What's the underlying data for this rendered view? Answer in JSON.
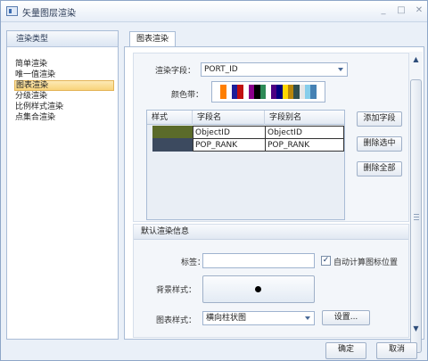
{
  "window": {
    "title": "矢量图层渲染",
    "controls": [
      "_",
      "□",
      "✕"
    ]
  },
  "left_panel": {
    "header": "渲染类型",
    "items": [
      {
        "label": "简单渲染",
        "selected": false
      },
      {
        "label": "唯一值渲染",
        "selected": false
      },
      {
        "label": "图表渲染",
        "selected": true
      },
      {
        "label": "分级渲染",
        "selected": false
      },
      {
        "label": "比例样式渲染",
        "selected": false
      },
      {
        "label": "点集合渲染",
        "selected": false
      }
    ]
  },
  "tabs": [
    {
      "label": "图表渲染",
      "active": true
    }
  ],
  "render_field": {
    "label": "渲染字段：",
    "value": "PORT_ID"
  },
  "color_ramp": {
    "label": "颜色带：",
    "colors": [
      "#ffffff",
      "#ff7f00",
      "#ffffff",
      "#1f1f99",
      "#c01010",
      "#ffffff",
      "#8b008b",
      "#000000",
      "#2e8b57",
      "#ffffff",
      "#4b0082",
      "#000080",
      "#ffd700",
      "#b8860b",
      "#2f4f4f",
      "#e6e6e6",
      "#87ceeb",
      "#4682b4",
      "#ffffff"
    ]
  },
  "field_table": {
    "columns": [
      "样式",
      "字段名",
      "字段别名"
    ],
    "rows": [
      {
        "color": "#5b6b2a",
        "field": "ObjectID",
        "alias": "ObjectID"
      },
      {
        "color": "#3c4a5f",
        "field": "POP_RANK",
        "alias": "POP_RANK"
      }
    ]
  },
  "buttons": {
    "add_field": "添加字段",
    "delete_selected": "删除选中",
    "delete_all": "删除全部",
    "settings": "设置...",
    "ok": "确定",
    "cancel": "取消"
  },
  "default_info": {
    "title": "默认渲染信息",
    "label_label": "标签：",
    "label_value": "",
    "auto_position_label": "自动计算图标位置",
    "auto_position_checked": true,
    "background_label": "背景样式：",
    "chart_style_label": "图表样式：",
    "chart_style_value": "横向柱状图"
  }
}
